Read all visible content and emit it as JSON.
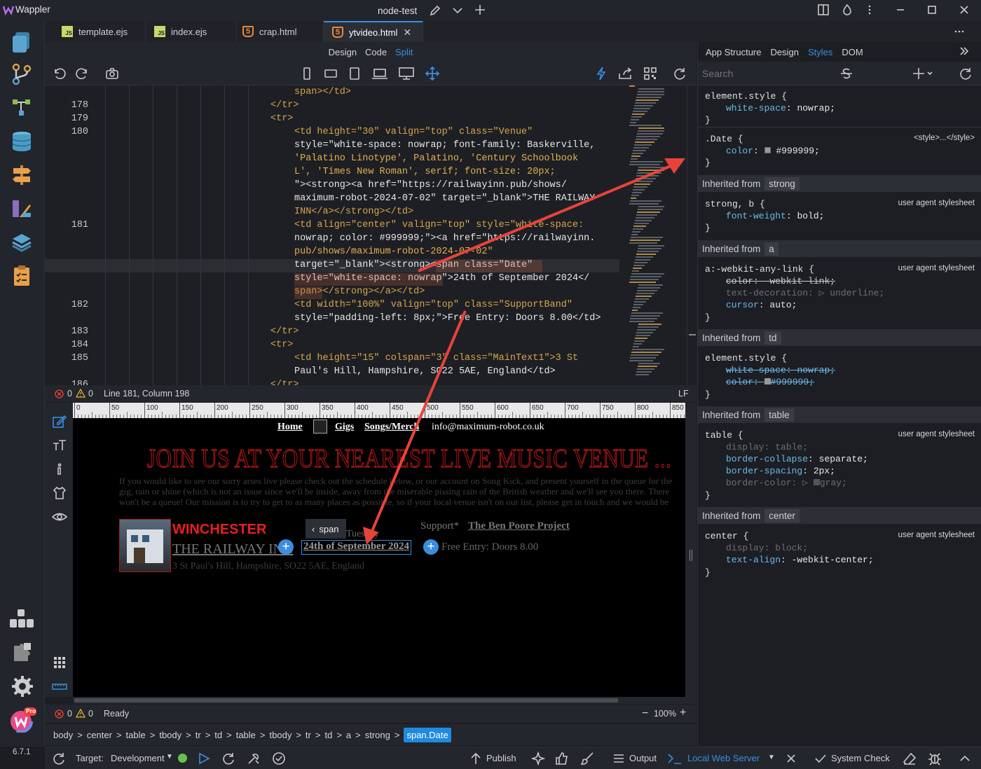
{
  "app": {
    "name": "Wappler",
    "project": "node-test",
    "version": "6.7.1",
    "pro_badge": "Pro"
  },
  "tabs": [
    {
      "label": "template.ejs",
      "icon": "js-file-icon"
    },
    {
      "label": "index.ejs",
      "icon": "js-file-icon"
    },
    {
      "label": "crap.html",
      "icon": "html5-file-icon"
    },
    {
      "label": "ytvideo.html",
      "icon": "html5-file-icon",
      "active": true
    }
  ],
  "view_modes": {
    "design": "Design",
    "code": "Code",
    "split": "Split",
    "active": "Split"
  },
  "right_tabs": {
    "structure": "App Structure",
    "design": "Design",
    "styles": "Styles",
    "dom": "DOM",
    "active": "Styles"
  },
  "search": {
    "placeholder": "Search"
  },
  "code": {
    "line_numbers": [
      "178",
      "179",
      "180",
      "181",
      "182",
      "183",
      "184",
      "185",
      "186"
    ],
    "lines": [
      "span></td>",
      "</tr>",
      "<tr>",
      "<td height=\"30\" valign=\"top\" class=\"Venue\"",
      "style=\"white-space: nowrap; font-family: Baskerville,",
      "'Palatino Linotype', Palatino, 'Century Schoolbook",
      "L', 'Times New Roman', serif; font-size: 20px;",
      "\"><strong><a href=\"https://railwayinn.pub/shows/",
      "maximum-robot-2024-07-02\" target=\"_blank\">THE RAILWAY",
      "INN</a></strong></td>",
      "<td align=\"center\" valign=\"top\" style=\"white-space:",
      "nowrap; color: #999999;\"><a href=\"https://railwayinn.",
      "pub/shows/maximum-robot-2024-07-02\"",
      "target=\"_blank\"><strong><span class=\"Date\"",
      "style=\"white-space: nowrap\">24th of September 2024</",
      "span></strong></a></td>",
      "<td width=\"100%\" valign=\"top\" class=\"SupportBand\"",
      "style=\"padding-left: 8px;\">Free Entry: Doors 8.00</td>",
      "</tr>",
      "<tr>",
      "<td height=\"15\" colspan=\"3\" class=\"MainText1\">3 St",
      "Paul's Hill, Hampshire, SO22 5AE, England</td>",
      "</tr>"
    ]
  },
  "editor_status": {
    "errors": "0",
    "warnings": "0",
    "position": "Line 181, Column 198",
    "eol": "LF"
  },
  "ruler_ticks": [
    "0",
    "50",
    "100",
    "150",
    "200",
    "250",
    "300",
    "350",
    "400",
    "450",
    "500",
    "550",
    "600",
    "650",
    "700",
    "750",
    "800",
    "850"
  ],
  "preview": {
    "nav": {
      "home": "Home",
      "gigs": "Gigs",
      "songs": "Songs/Merch",
      "email": "info@maximum-robot.co.uk"
    },
    "heading": "JOIN US AT YOUR NEAREST LIVE MUSIC VENUE ...",
    "intro": "If you would like to see our sorry arses live please check out the schedule below, or our account on Song Kick, and present yourself in the queue for the gig, rain or shine (which is not an issue since we'll be inside, away from the miserable pissing rain of the British weather and we'll see you there. There won't be a queue! Our mission is to try to get to as many places as possible, so if your local venue isn't on our list, please get in touch and we would be delighted to meet anybody who has listened to our music online ...",
    "town": "WINCHESTER",
    "venue": "THE RAILWAY INN",
    "day": "Tuesday",
    "date": "24th of September 2024",
    "support_label": "Support*",
    "support_band": "The Ben Poore Project",
    "entry": "Free Entry: Doors 8.00",
    "address": "3 St Paul's Hill, Hampshire, SO22 5AE, England",
    "selected_tag": "span"
  },
  "preview_status": {
    "errors": "0",
    "warnings": "0",
    "state": "Ready",
    "zoom": "100%"
  },
  "breadcrumbs": [
    "body",
    "center",
    "table",
    "tbody",
    "tr",
    "td",
    "table",
    "tbody",
    "tr",
    "td",
    "a",
    "strong",
    "span.Date"
  ],
  "styles": {
    "rule1": {
      "selector": "element.style {",
      "prop": "white-space",
      "value": "nowrap;"
    },
    "rule2": {
      "selector": ".Date {",
      "source": "<style>...</style>",
      "prop": "color",
      "value": "#999999;"
    },
    "inh_strong": {
      "label": "Inherited from",
      "tag": "strong"
    },
    "rule3": {
      "selector": "strong, b {",
      "source": "user agent stylesheet",
      "prop": "font-weight",
      "value": "bold;"
    },
    "inh_a": {
      "label": "Inherited from",
      "tag": "a"
    },
    "rule4": {
      "selector": "a:-webkit-any-link {",
      "source": "user agent stylesheet",
      "p1": "color",
      "v1": "-webkit-link;",
      "p2": "text-decoration",
      "v2": "underline;",
      "p3": "cursor",
      "v3": "auto;"
    },
    "inh_td": {
      "label": "Inherited from",
      "tag": "td"
    },
    "rule5": {
      "selector": "element.style {",
      "p1": "white-space",
      "v1": "nowrap;",
      "p2": "color",
      "v2": "#999999;"
    },
    "inh_table": {
      "label": "Inherited from",
      "tag": "table"
    },
    "rule6": {
      "selector": "table {",
      "source": "user agent stylesheet",
      "p1": "display",
      "v1": "table;",
      "p2": "border-collapse",
      "v2": "separate;",
      "p3": "border-spacing",
      "v3": "2px;",
      "p4": "border-color",
      "v4": "gray;"
    },
    "inh_center": {
      "label": "Inherited from",
      "tag": "center"
    },
    "rule7": {
      "selector": "center {",
      "source": "user agent stylesheet",
      "p1": "display",
      "v1": "block;",
      "p2": "text-align",
      "v2": "-webkit-center;"
    },
    "close": "}"
  },
  "bottom": {
    "target_label": "Target:",
    "target": "Development",
    "publish": "Publish",
    "output": "Output",
    "server": "Local Web Server",
    "system_check": "System Check"
  },
  "colors": {
    "accent": "#3b8ddf",
    "heading_red": "#b01818",
    "annotation_arrow": "#e8433a",
    "date_grey": "#999999"
  }
}
